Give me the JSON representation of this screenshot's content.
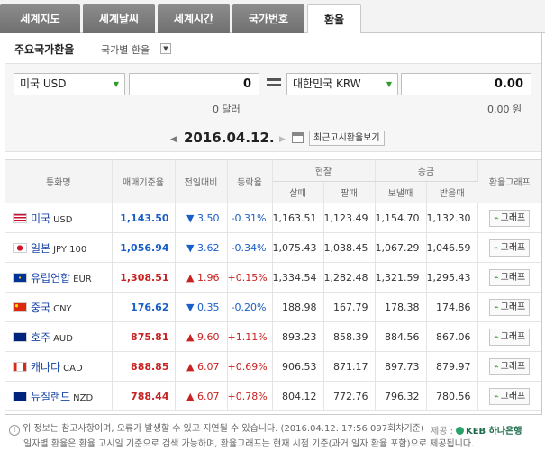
{
  "tabs": [
    {
      "label": "세계지도",
      "active": false
    },
    {
      "label": "세계날씨",
      "active": false
    },
    {
      "label": "세계시간",
      "active": false
    },
    {
      "label": "국가번호",
      "active": false
    },
    {
      "label": "환율",
      "active": true
    }
  ],
  "subbar": {
    "title": "주요국가환율",
    "link": "국가별 환율",
    "dropdown_icon": "chevron-down-icon"
  },
  "converter": {
    "from_currency": "미국 USD",
    "from_value": "0",
    "from_amount_text": "0 달러",
    "to_currency": "대한민국 KRW",
    "to_value": "0.00",
    "to_amount_text": "0.00 원",
    "date": "2016.04.12.",
    "notice_button": "최근고시환율보기"
  },
  "table": {
    "headers": {
      "currency": "통화명",
      "rate": "매매기준율",
      "change": "전일대비",
      "percent": "등락율",
      "cash": "현찰",
      "cash_buy": "살때",
      "cash_sell": "팔때",
      "remit": "송금",
      "remit_send": "보낼때",
      "remit_receive": "받을때",
      "graph": "환율그래프"
    },
    "graph_label": "그래프",
    "rows": [
      {
        "flag": "us",
        "name": "미국",
        "code": "USD",
        "rate": "1,143.50",
        "dir": "down",
        "arrow": "▼",
        "change": "3.50",
        "percent": "-0.31%",
        "cash_buy": "1,163.51",
        "cash_sell": "1,123.49",
        "send": "1,154.70",
        "receive": "1,132.30"
      },
      {
        "flag": "jp",
        "name": "일본",
        "code": "JPY 100",
        "rate": "1,056.94",
        "dir": "down",
        "arrow": "▼",
        "change": "3.62",
        "percent": "-0.34%",
        "cash_buy": "1,075.43",
        "cash_sell": "1,038.45",
        "send": "1,067.29",
        "receive": "1,046.59"
      },
      {
        "flag": "eu",
        "name": "유럽연합",
        "code": "EUR",
        "rate": "1,308.51",
        "dir": "up",
        "arrow": "▲",
        "change": "1.96",
        "percent": "+0.15%",
        "cash_buy": "1,334.54",
        "cash_sell": "1,282.48",
        "send": "1,321.59",
        "receive": "1,295.43"
      },
      {
        "flag": "cn",
        "name": "중국",
        "code": "CNY",
        "rate": "176.62",
        "dir": "down",
        "arrow": "▼",
        "change": "0.35",
        "percent": "-0.20%",
        "cash_buy": "188.98",
        "cash_sell": "167.79",
        "send": "178.38",
        "receive": "174.86"
      },
      {
        "flag": "au",
        "name": "호주",
        "code": "AUD",
        "rate": "875.81",
        "dir": "up",
        "arrow": "▲",
        "change": "9.60",
        "percent": "+1.11%",
        "cash_buy": "893.23",
        "cash_sell": "858.39",
        "send": "884.56",
        "receive": "867.06"
      },
      {
        "flag": "ca",
        "name": "캐나다",
        "code": "CAD",
        "rate": "888.85",
        "dir": "up",
        "arrow": "▲",
        "change": "6.07",
        "percent": "+0.69%",
        "cash_buy": "906.53",
        "cash_sell": "871.17",
        "send": "897.73",
        "receive": "879.97"
      },
      {
        "flag": "nz",
        "name": "뉴질랜드",
        "code": "NZD",
        "rate": "788.44",
        "dir": "up",
        "arrow": "▲",
        "change": "6.07",
        "percent": "+0.78%",
        "cash_buy": "804.12",
        "cash_sell": "772.76",
        "send": "796.32",
        "receive": "780.56"
      }
    ]
  },
  "footer": {
    "line1": "위 정보는 참고사항이며, 오류가 발생할 수 있고 지연될 수 있습니다. (2016.04.12. 17:56 097회차기준)",
    "line2": "일자별 환율은 환율 고시일 기준으로 검색 가능하며, 환율그래프는 현재 시점 기준(과거 일자 환율 포함)으로 제공됩니다.",
    "provider_label": "제공 :",
    "provider_name": "KEB 하나은행"
  },
  "colors": {
    "down": "#1a5fc7",
    "up": "#c92222",
    "spark": "#2d9b2d"
  }
}
